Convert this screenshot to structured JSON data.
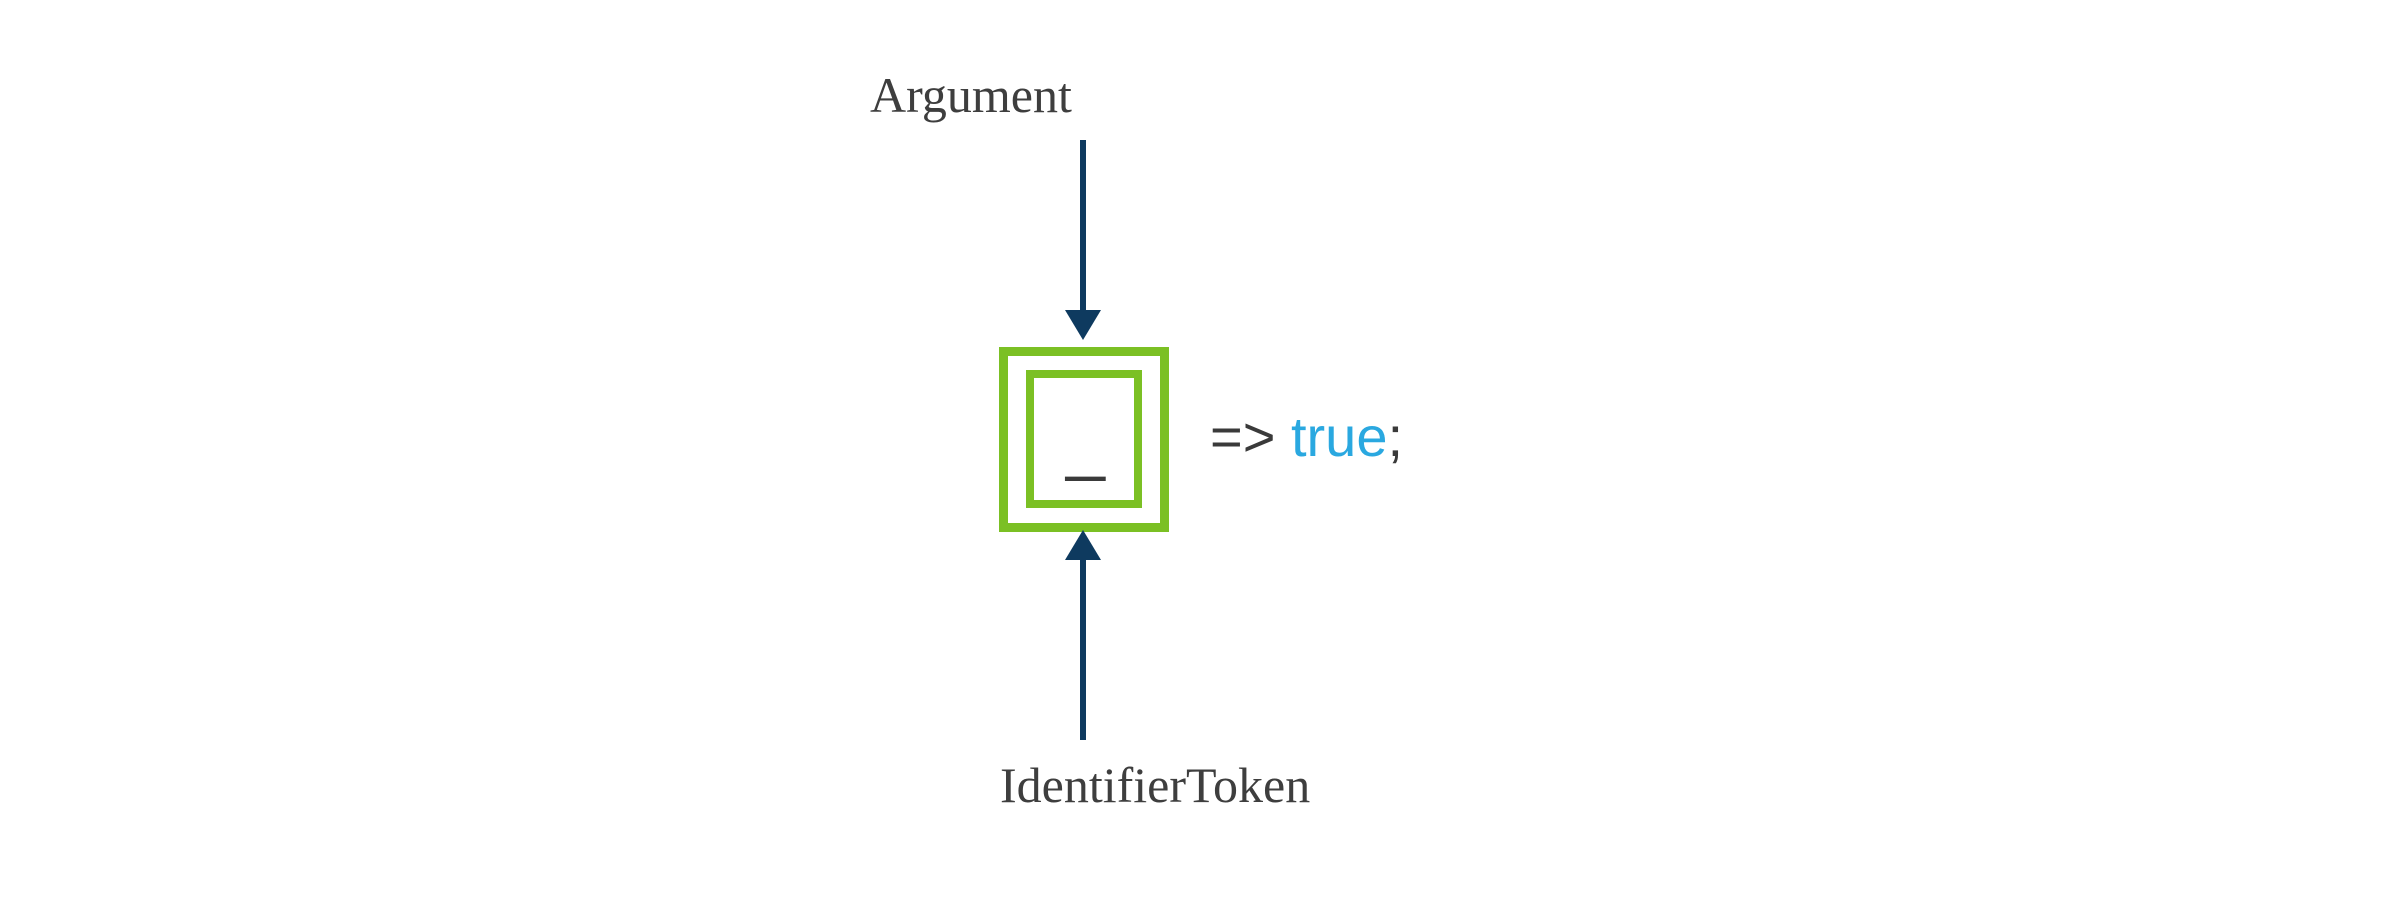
{
  "labels": {
    "top": "Argument",
    "bottom": "IdentifierToken"
  },
  "code": {
    "arrow_op": "=>",
    "space": "  ",
    "true_kw": "true",
    "semicolon": ";"
  },
  "box": {
    "underscore": "_"
  },
  "colors": {
    "arrow": "#0e3a5f",
    "box_border": "#7bc024",
    "text": "#3a3a3a",
    "keyword": "#2aa8e0"
  }
}
